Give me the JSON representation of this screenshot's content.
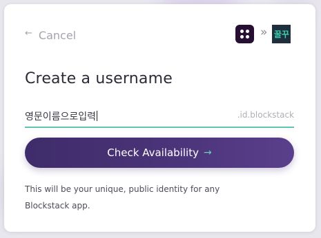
{
  "nav": {
    "cancel_label": "Cancel"
  },
  "brand": {
    "connector": "»",
    "app_logo_text": "꿀꾸"
  },
  "form": {
    "heading": "Create a username",
    "username_value": "영문이름으로입력",
    "username_suffix": ".id.blockstack",
    "submit_label": "Check Availability"
  },
  "help": {
    "text": "This will be your unique, public identity for any Blockstack app."
  },
  "colors": {
    "accent_purple": "#3f2c6a",
    "accent_teal": "#5ec4b6",
    "blockstack_logo": "#270f34"
  }
}
